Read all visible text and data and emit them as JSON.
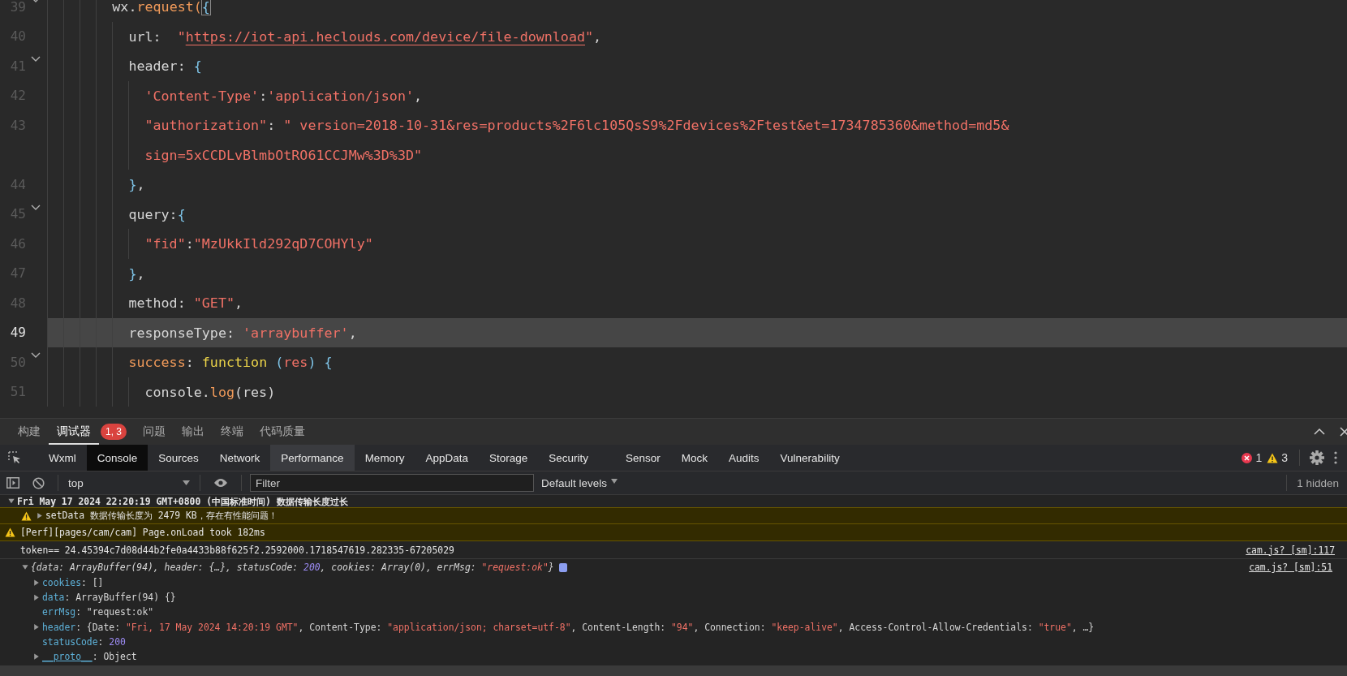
{
  "editor": {
    "lines": [
      {
        "number": "39",
        "fold": true,
        "current": false,
        "tokens": [
          {
            "text": "wx.",
            "kind": "plain"
          },
          {
            "text": "request(",
            "kind": "method"
          },
          {
            "text": "{",
            "kind": "matched-brace"
          }
        ],
        "children": [
          {
            "number": "40",
            "fold": false,
            "current": false,
            "tokens": [
              {
                "text": "url:  ",
                "kind": "plain"
              },
              {
                "text": "\"",
                "kind": "string"
              },
              {
                "text": "https://iot-api.heclouds.com/device/file-download",
                "kind": "link"
              },
              {
                "text": "\"",
                "kind": "string"
              },
              {
                "text": ",",
                "kind": "plain"
              }
            ]
          },
          {
            "number": "41",
            "fold": true,
            "current": false,
            "tokens": [
              {
                "text": "header: ",
                "kind": "plain"
              },
              {
                "text": "{",
                "kind": "brace"
              }
            ],
            "children": [
              {
                "number": "42",
                "fold": false,
                "current": false,
                "tokens": [
                  {
                    "text": "'Content-Type'",
                    "kind": "string"
                  },
                  {
                    "text": ":",
                    "kind": "plain"
                  },
                  {
                    "text": "'application/json'",
                    "kind": "string"
                  },
                  {
                    "text": ",",
                    "kind": "plain"
                  }
                ]
              },
              {
                "number": "43",
                "fold": false,
                "current": false,
                "tokens": [
                  {
                    "text": "\"authorization\"",
                    "kind": "string"
                  },
                  {
                    "text": ": ",
                    "kind": "plain"
                  },
                  {
                    "text": "\" version=2018-10-31&res=products%2F6lc105QsS9%2Fdevices%2Ftest&et=1734785360&method=md5&",
                    "kind": "string"
                  }
                ]
              },
              {
                "fold": false,
                "current": false,
                "tokens": [
                  {
                    "text": "sign=5xCCDLvBlmbOtRO61CCJMw%3D%3D\"",
                    "kind": "string"
                  }
                ]
              }
            ]
          },
          {
            "number": "44",
            "fold": false,
            "current": false,
            "tokens": [
              {
                "text": "}",
                "kind": "brace"
              },
              {
                "text": ",",
                "kind": "plain"
              }
            ]
          },
          {
            "number": "45",
            "fold": true,
            "current": false,
            "tokens": [
              {
                "text": "query:",
                "kind": "plain"
              },
              {
                "text": "{",
                "kind": "brace"
              }
            ],
            "children": [
              {
                "number": "46",
                "fold": false,
                "current": false,
                "tokens": [
                  {
                    "text": "\"fid\"",
                    "kind": "string"
                  },
                  {
                    "text": ":",
                    "kind": "plain"
                  },
                  {
                    "text": "\"MzUkkIld292qD7COHYly\"",
                    "kind": "string"
                  }
                ]
              }
            ]
          },
          {
            "number": "47",
            "fold": false,
            "current": false,
            "tokens": [
              {
                "text": "}",
                "kind": "brace"
              },
              {
                "text": ",",
                "kind": "plain"
              }
            ]
          },
          {
            "number": "48",
            "fold": false,
            "current": false,
            "tokens": [
              {
                "text": "method: ",
                "kind": "plain"
              },
              {
                "text": "\"GET\"",
                "kind": "string"
              },
              {
                "text": ",",
                "kind": "plain"
              }
            ]
          },
          {
            "number": "49",
            "fold": false,
            "current": true,
            "tokens": [
              {
                "text": "responseType: ",
                "kind": "plain"
              },
              {
                "text": "'arraybuffer'",
                "kind": "string"
              },
              {
                "text": ",",
                "kind": "plain"
              }
            ]
          },
          {
            "number": "50",
            "fold": true,
            "current": false,
            "tokens": [
              {
                "text": "success",
                "kind": "key"
              },
              {
                "text": ": ",
                "kind": "plain"
              },
              {
                "text": "function",
                "kind": "keyword"
              },
              {
                "text": " (",
                "kind": "brace"
              },
              {
                "text": "res",
                "kind": "string"
              },
              {
                "text": ") {",
                "kind": "brace"
              }
            ],
            "children": [
              {
                "number": "51",
                "fold": false,
                "current": false,
                "tokens": [
                  {
                    "text": "console.",
                    "kind": "plain"
                  },
                  {
                    "text": "log",
                    "kind": "method"
                  },
                  {
                    "text": "(res)",
                    "kind": "plain"
                  }
                ]
              }
            ]
          }
        ]
      }
    ]
  },
  "panel_tabs": [
    {
      "label": "构建",
      "selected": false
    },
    {
      "label": "调试器",
      "selected": true,
      "badge": "1, 3"
    },
    {
      "label": "问题",
      "selected": false
    },
    {
      "label": "输出",
      "selected": false
    },
    {
      "label": "终端",
      "selected": false
    },
    {
      "label": "代码质量",
      "selected": false
    }
  ],
  "devtools": {
    "tabs": [
      {
        "label": "Wxml",
        "selected": false,
        "hovered": false
      },
      {
        "label": "Console",
        "selected": true,
        "hovered": false
      },
      {
        "label": "Sources",
        "selected": false,
        "hovered": false
      },
      {
        "label": "Network",
        "selected": false,
        "hovered": false
      },
      {
        "label": "Performance",
        "selected": false,
        "hovered": true
      },
      {
        "label": "Memory",
        "selected": false,
        "hovered": false
      },
      {
        "label": "AppData",
        "selected": false,
        "hovered": false
      },
      {
        "label": "Storage",
        "selected": false,
        "hovered": false
      },
      {
        "label": "Security",
        "selected": false,
        "hovered": false
      },
      {
        "label": "Sensor",
        "selected": false,
        "hovered": false
      },
      {
        "label": "Mock",
        "selected": false,
        "hovered": false
      },
      {
        "label": "Audits",
        "selected": false,
        "hovered": false
      },
      {
        "label": "Vulnerability",
        "selected": false,
        "hovered": false
      }
    ],
    "error_count": "1",
    "warning_count": "3"
  },
  "toolbar": {
    "context": "top",
    "filter": {
      "placeholder": "Filter"
    },
    "levels": "Default levels",
    "hidden_count": "1 hidden"
  },
  "console": {
    "entries": [
      {
        "kind": "group",
        "expanded": true,
        "text": "Fri May 17 2024 22:20:19 GMT+0800 (中国标准时间) 数据传输长度过长",
        "children": [
          {
            "kind": "warning",
            "expanded": false,
            "text": "setData 数据传输长度为 2479 KB，存在有性能问题！"
          }
        ]
      },
      {
        "kind": "warning",
        "text": "[Perf][pages/cam/cam] Page.onLoad took 182ms"
      },
      {
        "kind": "log",
        "text": "token== 24.45394c7d08d44b2fe0a4433b88f625f2.2592000.1718547619.282335-67205029",
        "source": "cam.js? [sm]:117"
      },
      {
        "kind": "object",
        "expanded": true,
        "source": "cam.js? [sm]:51",
        "summary": [
          {
            "text": "{data: ArrayBuffer(94), header: {…}, statusCode: ",
            "kind": "plain"
          },
          {
            "text": "200",
            "kind": "number"
          },
          {
            "text": ", cookies: Array(0), errMsg: ",
            "kind": "plain"
          },
          {
            "text": "\"request:ok\"",
            "kind": "string"
          },
          {
            "text": "}",
            "kind": "plain"
          }
        ],
        "properties": [
          {
            "name": "cookies",
            "kind": "property",
            "expanded": false,
            "value": [
              {
                "text": ": []",
                "kind": "plain"
              }
            ]
          },
          {
            "name": "data",
            "kind": "property",
            "expanded": false,
            "value": [
              {
                "text": ": ArrayBuffer(94) {}",
                "kind": "plain"
              }
            ]
          },
          {
            "name": "errMsg",
            "kind": "property",
            "value": [
              {
                "text": ": \"request:ok\"",
                "kind": "plain"
              }
            ]
          },
          {
            "name": "header",
            "kind": "property",
            "expanded": false,
            "value": [
              {
                "text": ": {Date: ",
                "kind": "plain"
              },
              {
                "text": "\"Fri, 17 May 2024 14:20:19 GMT\"",
                "kind": "string"
              },
              {
                "text": ", Content-Type: ",
                "kind": "plain"
              },
              {
                "text": "\"application/json; charset=utf-8\"",
                "kind": "string"
              },
              {
                "text": ", Content-Length: ",
                "kind": "plain"
              },
              {
                "text": "\"94\"",
                "kind": "string"
              },
              {
                "text": ", Connection: ",
                "kind": "plain"
              },
              {
                "text": "\"keep-alive\"",
                "kind": "string"
              },
              {
                "text": ", Access-Control-Allow-Credentials: ",
                "kind": "plain"
              },
              {
                "text": "\"true\"",
                "kind": "string"
              },
              {
                "text": ", …}",
                "kind": "plain"
              }
            ]
          },
          {
            "name": "statusCode",
            "kind": "property",
            "value": [
              {
                "text": ": ",
                "kind": "plain"
              },
              {
                "text": "200",
                "kind": "number"
              }
            ]
          },
          {
            "name": "__proto__",
            "kind": "internal",
            "expanded": false,
            "value": [
              {
                "text": ": Object",
                "kind": "plain"
              }
            ]
          }
        ]
      }
    ]
  }
}
